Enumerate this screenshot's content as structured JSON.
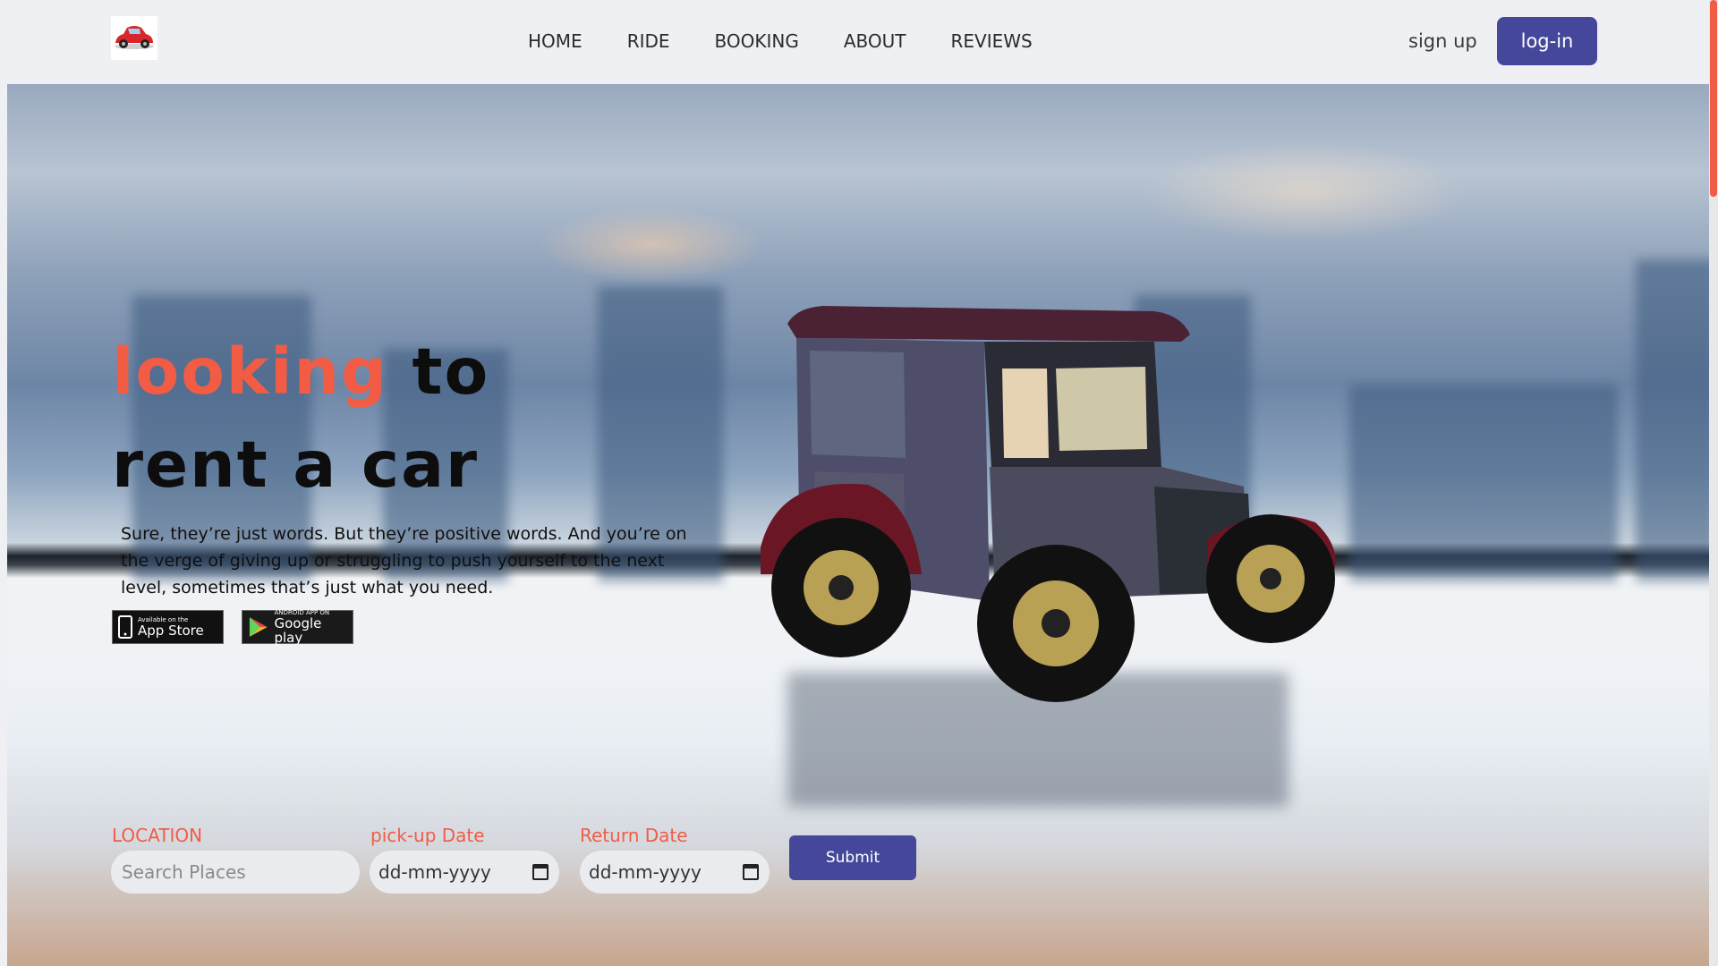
{
  "nav": {
    "links": [
      "HOME",
      "RIDE",
      "BOOKING",
      "ABOUT",
      "REVIEWS"
    ],
    "signup_label": "sign up",
    "login_label": "log-in"
  },
  "hero": {
    "headline_accent": "looking",
    "headline_rest_1": "to",
    "headline_line_2": "rent a car",
    "tagline": "Sure, they’re just words. But they’re positive words. And you’re on the verge of giving up or struggling to push yourself to the next level, sometimes that’s just what you need.",
    "app_store": {
      "small": "Available on the",
      "big": "App Store"
    },
    "google_play": {
      "small": "ANDROID APP ON",
      "big": "Google play"
    }
  },
  "form": {
    "location_label": "LOCATION",
    "location_placeholder": "Search Places",
    "pickup_label": "pick-up Date",
    "pickup_value": "dd-mm-yyyy",
    "return_label": "Return Date",
    "return_value": "dd-mm-yyyy",
    "submit_label": "Submit"
  },
  "colors": {
    "accent": "#f25c45",
    "primary": "#45489a",
    "nav_bg": "#eef0f3"
  }
}
